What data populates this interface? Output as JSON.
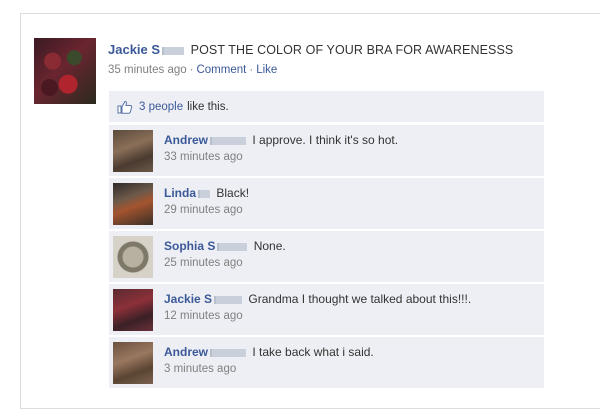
{
  "post": {
    "author": "Jackie S",
    "status": "POST THE COLOR OF YOUR BRA FOR AWARENESSS",
    "time": "35 minutes ago",
    "comment_link": "Comment",
    "like_link": "Like",
    "separator": "·"
  },
  "likes": {
    "count_link": "3 people",
    "rest": "like this."
  },
  "comments": [
    {
      "author": "Andrew",
      "text": "I approve. I think it's so hot.",
      "time": "33 minutes ago"
    },
    {
      "author": "Linda",
      "text": "Black!",
      "time": "29 minutes ago"
    },
    {
      "author": "Sophia S",
      "text": "None.",
      "time": "25 minutes ago"
    },
    {
      "author": "Jackie S",
      "text": "Grandma I thought we talked about this!!!.",
      "time": "12 minutes ago"
    },
    {
      "author": "Andrew",
      "text": "I take back what i said.",
      "time": "3 minutes ago"
    }
  ],
  "icons": {
    "like": "thumbs-up-icon"
  },
  "colors": {
    "link": "#3b5998",
    "panel": "#edeff4",
    "meta": "#808080"
  }
}
